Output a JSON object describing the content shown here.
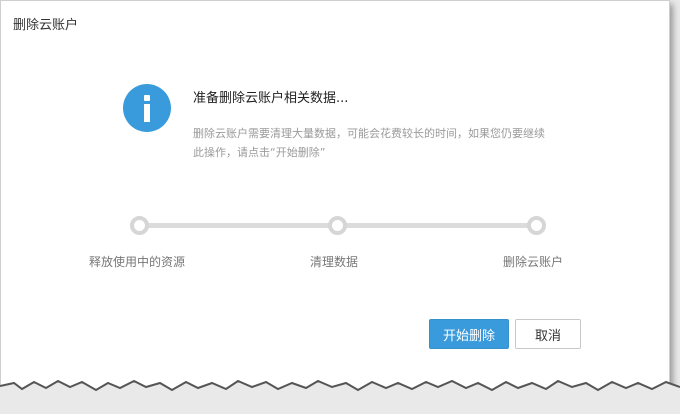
{
  "dialog": {
    "title": "删除云账户",
    "heading": "准备删除云账户相关数据...",
    "description": "删除云账户需要清理大量数据，可能会花费较长的时间，如果您仍要继续此操作，请点击“开始删除”"
  },
  "steps": [
    {
      "label": "释放使用中的资源"
    },
    {
      "label": "清理数据"
    },
    {
      "label": "删除云账户"
    }
  ],
  "buttons": {
    "start": "开始删除",
    "cancel": "取消"
  },
  "colors": {
    "accent": "#3a9bdc",
    "track": "#dcdcdc"
  }
}
